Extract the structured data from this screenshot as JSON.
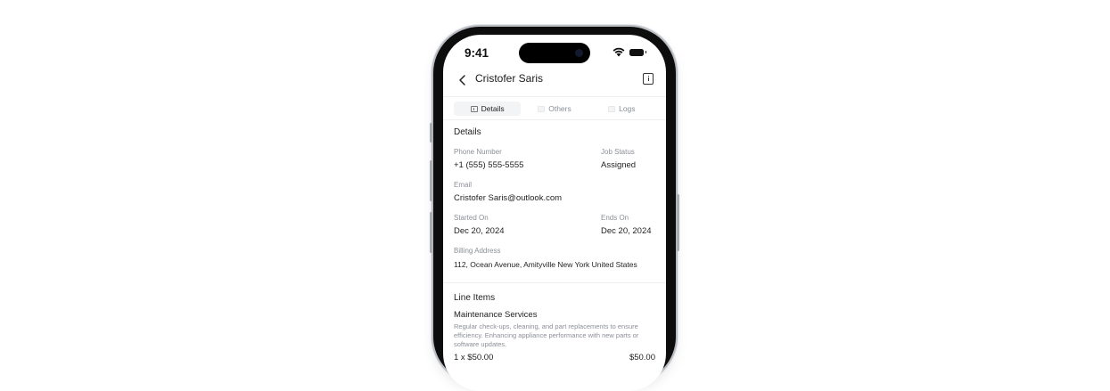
{
  "status_bar": {
    "time": "9:41"
  },
  "header": {
    "title": "Cristofer Saris"
  },
  "tabs": [
    {
      "label": "Details",
      "active": true
    },
    {
      "label": "Others",
      "active": false
    },
    {
      "label": "Logs",
      "active": false
    }
  ],
  "details": {
    "title": "Details",
    "phone_label": "Phone Number",
    "phone_value": "+1 (555) 555-5555",
    "job_status_label": "Job Status",
    "job_status_value": "Assigned",
    "email_label": "Email",
    "email_value": "Cristofer Saris@outlook.com",
    "started_label": "Started On",
    "started_value": "Dec 20, 2024",
    "ends_label": "Ends On",
    "ends_value": "Dec 20, 2024",
    "billing_label": "Billing Address",
    "billing_value": "112, Ocean Avenue, Amityville New York United States"
  },
  "line_items": {
    "title": "Line Items",
    "items": [
      {
        "name": "Maintenance Services",
        "description": "Regular check-ups, cleaning, and part replacements to ensure efficiency. Enhancing appliance performance with new parts or software updates.",
        "qty_price": "1 x $50.00",
        "total": "$50.00"
      }
    ]
  },
  "icons": {
    "back": "chevron-left-icon",
    "info": "info-icon",
    "wifi": "wifi-icon",
    "battery": "battery-icon",
    "details_tab": "document-icon"
  },
  "colors": {
    "muted_text": "#8b8f97",
    "text": "#1f1f1f",
    "phone_frame": "#0d0d0e"
  }
}
